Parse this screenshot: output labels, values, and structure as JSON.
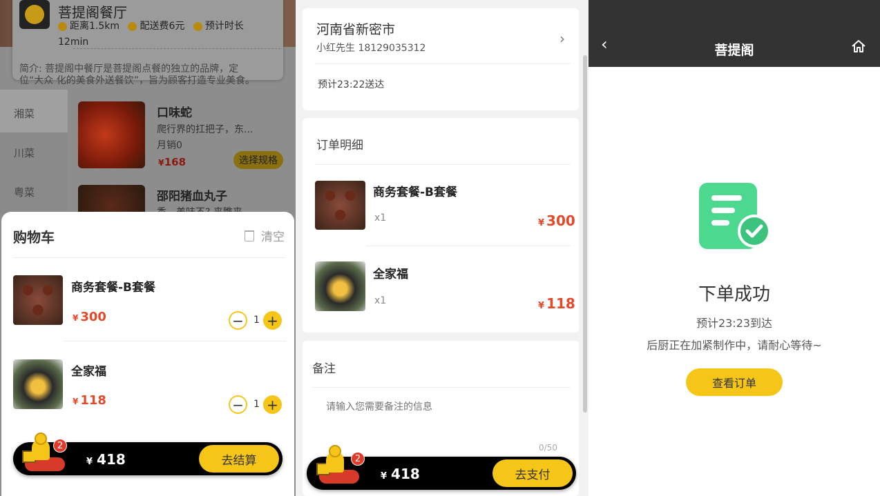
{
  "shop": {
    "name": "菩提阁餐厅",
    "distance": "距离1.5km",
    "delivery_fee": "配送费6元",
    "eta_label": "预计时长",
    "eta_value": "12min",
    "intro": "简介: 菩提阁中餐厅是菩提阁点餐的独立的品牌，定位“大众 化的美食外送餐饮”，旨为顾客打造专业美食。"
  },
  "categories": [
    "湘菜",
    "川菜",
    "粤菜"
  ],
  "menu": [
    {
      "name": "口味蛇",
      "desc": "爬行界的扛把子，东...",
      "sales": "月销0",
      "price": "168",
      "currency": "¥",
      "action": "选择规格"
    },
    {
      "name": "邵阳猪血丸子",
      "desc": "香，美味不? 来瞧来"
    }
  ],
  "cart": {
    "title": "购物车",
    "clear_label": "清空",
    "items": [
      {
        "name": "商务套餐-B套餐",
        "currency": "¥",
        "price": "300",
        "qty": "1"
      },
      {
        "name": "全家福",
        "currency": "¥",
        "price": "118",
        "qty": "1"
      }
    ],
    "badge_count": "2",
    "currency": "¥",
    "total": "418",
    "checkout_label": "去结算"
  },
  "order": {
    "address_city": "河南省新密市",
    "contact": "小红先生  18129035312",
    "eta": "预计23:22送达",
    "detail_title": "订单明细",
    "items": [
      {
        "name": "商务套餐-B套餐",
        "qty": "x1",
        "currency": "¥",
        "price": "300"
      },
      {
        "name": "全家福",
        "qty": "x1",
        "currency": "¥",
        "price": "118"
      }
    ],
    "remark_title": "备注",
    "remark_placeholder": "请输入您需要备注的信息",
    "remark_counter": "0/50",
    "badge_count": "2",
    "currency": "¥",
    "total": "418",
    "pay_label": "去支付"
  },
  "success": {
    "nav_title": "菩提阁",
    "title": "下单成功",
    "eta": "预计23:23到达",
    "message": "后厨正在加紧制作中，请耐心等待~",
    "view_order_label": "查看订单"
  },
  "colors": {
    "accent": "#f5c518",
    "price": "#e44a2a",
    "success_icon": "#4cd98f",
    "nav_bg": "#333333"
  }
}
